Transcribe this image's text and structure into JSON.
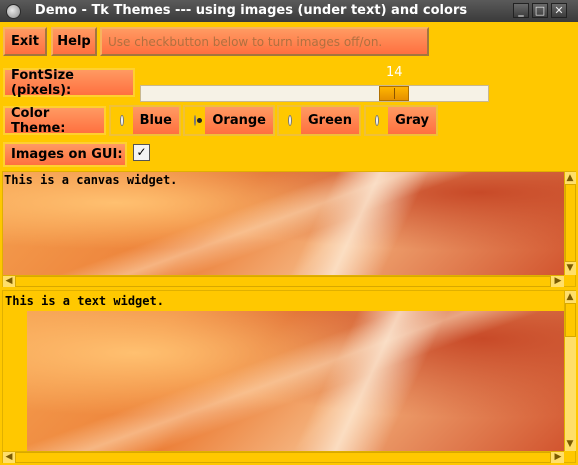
{
  "window": {
    "title": "Demo - Tk Themes --- using images (under text) and colors"
  },
  "window_controls": {
    "minimize": "_",
    "maximize": "□",
    "close": "✕"
  },
  "toolbar": {
    "exit_label": "Exit",
    "help_label": "Help",
    "hint": "Use checkbutton below to turn images off/on."
  },
  "font_size": {
    "label": "FontSize (pixels):",
    "value": "14"
  },
  "color_theme": {
    "label": "Color Theme:",
    "options": [
      "Blue",
      "Orange",
      "Green",
      "Gray"
    ],
    "selected": "Orange"
  },
  "images_on_gui": {
    "label": "Images on GUI:",
    "check": "✓",
    "checked": true
  },
  "canvas": {
    "text": "This is a canvas widget."
  },
  "text_widget": {
    "text": "This is a text widget."
  },
  "colors": {
    "background": "#ffc800",
    "button": "#ff7a48"
  }
}
